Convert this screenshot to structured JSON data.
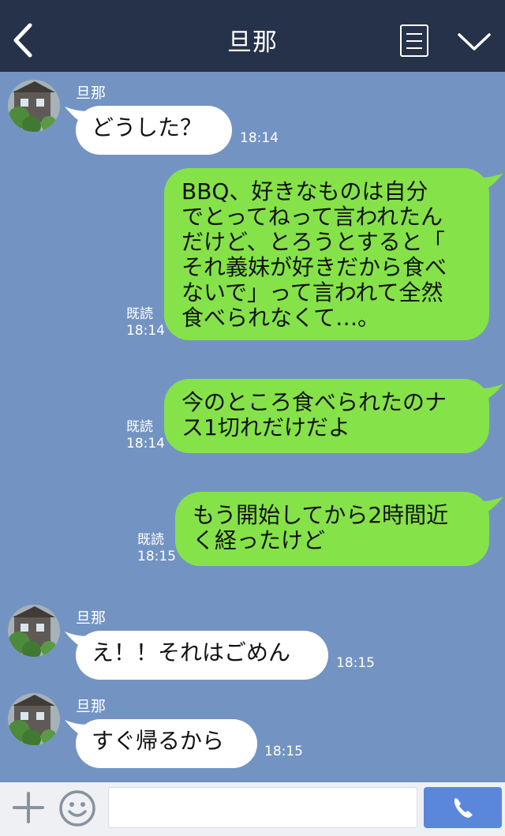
{
  "header": {
    "title": "旦那",
    "back_icon": "chevron-left-icon",
    "menu_icon": "menu-lines-icon",
    "expand_icon": "chevron-down-icon"
  },
  "messages": [
    {
      "sender": "旦那",
      "text": "どうした？",
      "time": "18:14"
    },
    {
      "text_lines": [
        "BBQ、好きなものは自分",
        "でとってねって言われたん",
        "だけど、とろうとすると「",
        "それ義妹が好きだから食べ",
        "ないで」って言われて全然",
        "食べられなくて…。"
      ],
      "read": "既読",
      "time": "18:14"
    },
    {
      "text_lines": [
        "今のところ食べられたのナ",
        "ス1切れだけだよ"
      ],
      "read": "既読",
      "time": "18:14"
    },
    {
      "text_lines": [
        "もう開始してから2時間近",
        "く経ったけど"
      ],
      "read": "既読",
      "time": "18:15"
    },
    {
      "sender": "旦那",
      "text": "え！！それはごめん",
      "time": "18:15"
    },
    {
      "sender": "旦那",
      "text": "すぐ帰るから",
      "time": "18:15"
    }
  ],
  "bottom_bar": {
    "input_value": "",
    "plus_icon": "plus-icon",
    "emoji_icon": "smiley-icon",
    "call_icon": "phone-icon"
  },
  "colors": {
    "header": "#263249",
    "chat_bg": "#7394c2",
    "incoming": "#ffffff",
    "outgoing": "#85e249",
    "call_button": "#5b87db"
  }
}
